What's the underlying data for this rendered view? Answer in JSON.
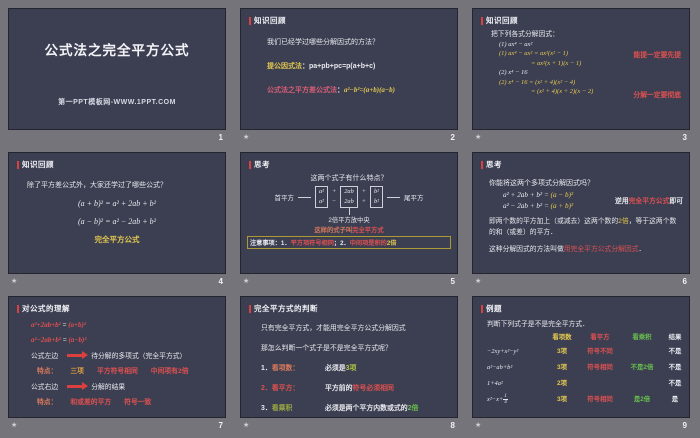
{
  "canvas": {
    "background": "#74747a"
  },
  "colors": {
    "slide_bg": "#3c3f52",
    "header_bar": "#d94040",
    "yellow": "#e3c84f",
    "red": "#dd5050",
    "green": "#68bd4d",
    "white_text": "#e7e8ed"
  },
  "slides": [
    {
      "number": "1",
      "title": "公式法之完全平方公式",
      "footer": "第一PPT模板网-WWW.1PPT.COM"
    },
    {
      "number": "2",
      "header": "知识回顾",
      "question": "我们已经学过哪些分解因式的方法？",
      "method1_label": "提公因式法",
      "method1_formula": "：pa+pb+pc=p(a+b+c)",
      "method2_label": "公式法之平方差公式法",
      "method2_colon": "：",
      "method2_formula": "a²−b²=(a+b)(a−b)"
    },
    {
      "number": "3",
      "header": "知识回顾",
      "intro": "把下列各式分解因式：",
      "p1_given": "(1) ax⁴ − ax²",
      "p1_step1": "(1) ax⁴ − ax² = ax²(x² − 1)",
      "p1_step2": "= ax²(x + 1)(x − 1)",
      "p1_note": "能提一定要先提",
      "p2_given": "(2) x⁴ − 16",
      "p2_step1": "(2) x⁴ − 16 = (x² + 4)(x² − 4)",
      "p2_step2": "= (x² + 4)(x + 2)(x − 2)",
      "p2_note": "分解一定要彻底"
    },
    {
      "number": "4",
      "header": "知识回顾",
      "question": "除了平方差公式外，大家还学过了哪些公式？",
      "formula1": "(a + b)² = a² + 2ab + b²",
      "formula2": "(a − b)² = a² − 2ab + b²",
      "caption": "完全平方公式"
    },
    {
      "number": "5",
      "header": "思考",
      "question": "这两个式子有什么特点？",
      "left_label": "首平方",
      "right_label": "尾平方",
      "box1_top": "a²",
      "box1_bottom": "a²",
      "sign1_top": "+",
      "sign1_bottom": "−",
      "box2_top": "2ab",
      "box2_bottom": "2ab",
      "sign2_top": "+",
      "sign2_bottom": "+",
      "box3_top": "b²",
      "box3_bottom": "b²",
      "middle_caption": "2倍平方放中央",
      "sentence_prefix": "这样的式子叫",
      "sentence_highlight": "完全平方式",
      "note_prefix": "注意事项：1．",
      "note_red1": "平方项符号相同",
      "note_mid": "；2．",
      "note_red2": "中间项是积的",
      "note_yellow": "2倍"
    },
    {
      "number": "6",
      "header": "思考",
      "question": "你能将这两个多项式分解因式吗？",
      "f1_left": "a² + 2ab + b² = ",
      "f1_right": "(a − b)²",
      "f2_left": "a² − 2ab + b² = ",
      "f2_right": "(a + b)²",
      "side_prefix": "逆用",
      "side_highlight": "完全平方公式",
      "side_suffix": "即可",
      "para_1": "即两个数的平方加上（或减去）这两个数的",
      "para_hl": "2倍",
      "para_2": "，等于这两个数的和（或差）的平方．",
      "method_prefix": "这种分解因式的方法叫做",
      "method_highlight": "用完全平方公式分解因式",
      "method_suffix": "．"
    },
    {
      "number": "7",
      "header": "对公式的理解",
      "formula1_left": "a²+2ab+b²",
      "formula1_eq": " = ",
      "formula1_right": "(a+b)²",
      "formula2_left": "a²−2ab+b²",
      "formula2_eq": " = ",
      "formula2_right": "(a−b)²",
      "row1_label": "公式左边",
      "row1_text": "待分解的多项式（完全平方式）",
      "row2_label": "特点：",
      "row2_item1": "三项",
      "row2_item2": "平方符号相同",
      "row2_item3": "中间项有2倍",
      "row3_label": "公式右边",
      "row3_text": "分解的结果",
      "row4_label": "特点：",
      "row4_item1": "和或差的平方",
      "row4_item2": "符号一致"
    },
    {
      "number": "8",
      "header": "完全平方式的判断",
      "line1": "只有完全平方式，才能用完全平方公式分解因式",
      "line2": "那怎么判断一个式子是不是完全平方式呢？",
      "item1_num": "1．",
      "item1_label": "看项数：",
      "item1_text": "必须是",
      "item1_hl": "3项",
      "item2_label": "2．看平方：",
      "item2_text": "平方前的",
      "item2_hl": "符号必须相同",
      "item3_num": "3．",
      "item3_label": "看乘积",
      "item3_text": "必须是两个平方内数或式的",
      "item3_hl": "2倍"
    },
    {
      "number": "9",
      "header": "例题",
      "intro": "判断下列式子是不是完全平方式．",
      "col1": "看项数",
      "col2": "看平方",
      "col3": "看乘积",
      "col4": "结果",
      "rows": [
        {
          "expr": "−2xy+x²−y²",
          "terms": "3项",
          "square": "符号不同",
          "product": "",
          "result": "不是"
        },
        {
          "expr": "a²−ab+b²",
          "terms": "3项",
          "square": "符号相同",
          "product": "不是2倍",
          "result": "不是"
        },
        {
          "expr": "1+4a²",
          "terms": "2项",
          "square": "",
          "product": "",
          "result": "不是"
        },
        {
          "expr_prefix": "x²−x+",
          "frac_num": "1",
          "frac_den": "4",
          "terms": "3项",
          "square": "符号相同",
          "product": "是2倍",
          "result": "是"
        }
      ]
    }
  ]
}
